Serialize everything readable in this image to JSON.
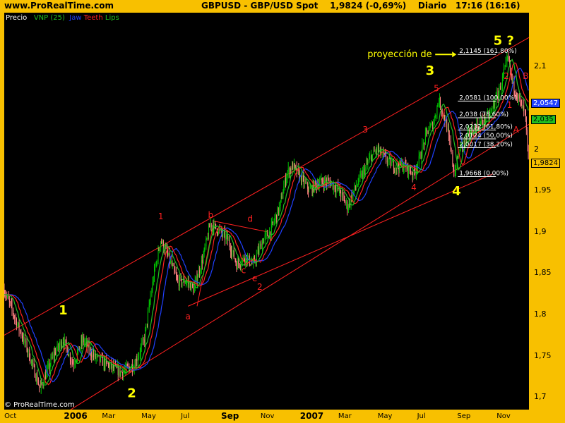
{
  "header": {
    "site": "www.ProRealTime.com",
    "symbol": "GBPUSD - GBP/USD Spot",
    "price": "1,9824 (-0,69%)",
    "period": "Diario",
    "time": "17:16 (16:16)"
  },
  "legend": {
    "price": "Precio",
    "vnp": "VNP (25)",
    "jaw": "Jaw",
    "teeth": "Teeth",
    "lips": "Lips"
  },
  "copyright": "© ProRealTime.com",
  "colors": {
    "background": "#f8c000",
    "plot": "#000000",
    "bull": "#00c000",
    "bear": "#ff8080",
    "jaw": "#2040ff",
    "teeth": "#ff2020",
    "lips": "#20c020",
    "channel": "#ff2020",
    "wave_label": "#ffff00",
    "sub_label": "#ff2020"
  },
  "chart_data": {
    "type": "candlestick",
    "ylim": [
      1.685,
      2.165
    ],
    "y_ticks": [
      "2,1",
      "2",
      "1,95",
      "1,9",
      "1,85",
      "1,8",
      "1,75",
      "1,7"
    ],
    "y_tick_values": [
      2.1,
      2.0,
      1.95,
      1.9,
      1.85,
      1.8,
      1.75,
      1.7
    ],
    "x_ticks": [
      "Oct",
      "2006",
      "Mar",
      "May",
      "Jul",
      "Sep",
      "Nov",
      "2007",
      "Mar",
      "May",
      "Jul",
      "Sep",
      "Nov"
    ],
    "x_ticks_year": [
      false,
      true,
      false,
      false,
      false,
      true,
      false,
      true,
      false,
      false,
      false,
      false,
      false
    ],
    "x_range": [
      "2005-09-20",
      "2007-12-10"
    ],
    "x_tick_dates": [
      "2005-10-01",
      "2006-01-01",
      "2006-03-01",
      "2006-05-01",
      "2006-07-01",
      "2006-09-01",
      "2006-11-01",
      "2007-01-01",
      "2007-03-01",
      "2007-05-01",
      "2007-07-01",
      "2007-09-01",
      "2007-11-01"
    ],
    "path": [
      [
        "2005-09-20",
        1.83
      ],
      [
        "2005-10-05",
        1.8
      ],
      [
        "2005-10-25",
        1.76
      ],
      [
        "2005-11-15",
        1.71
      ],
      [
        "2005-12-05",
        1.75
      ],
      [
        "2005-12-20",
        1.77
      ],
      [
        "2006-01-05",
        1.74
      ],
      [
        "2006-01-20",
        1.77
      ],
      [
        "2006-02-05",
        1.75
      ],
      [
        "2006-02-25",
        1.74
      ],
      [
        "2006-03-20",
        1.73
      ],
      [
        "2006-04-10",
        1.74
      ],
      [
        "2006-04-25",
        1.77
      ],
      [
        "2006-05-10",
        1.85
      ],
      [
        "2006-05-20",
        1.89
      ],
      [
        "2006-06-01",
        1.87
      ],
      [
        "2006-06-15",
        1.84
      ],
      [
        "2006-06-30",
        1.84
      ],
      [
        "2006-07-10",
        1.83
      ],
      [
        "2006-07-25",
        1.87
      ],
      [
        "2006-08-05",
        1.91
      ],
      [
        "2006-08-20",
        1.9
      ],
      [
        "2006-09-01",
        1.89
      ],
      [
        "2006-09-15",
        1.86
      ],
      [
        "2006-09-28",
        1.87
      ],
      [
        "2006-10-10",
        1.86
      ],
      [
        "2006-10-25",
        1.89
      ],
      [
        "2006-11-05",
        1.9
      ],
      [
        "2006-11-20",
        1.93
      ],
      [
        "2006-12-01",
        1.97
      ],
      [
        "2006-12-10",
        1.98
      ],
      [
        "2007-01-05",
        1.95
      ],
      [
        "2007-01-20",
        1.96
      ],
      [
        "2007-02-05",
        1.96
      ],
      [
        "2007-02-20",
        1.95
      ],
      [
        "2007-03-05",
        1.93
      ],
      [
        "2007-03-15",
        1.95
      ],
      [
        "2007-03-28",
        1.97
      ],
      [
        "2007-04-10",
        1.99
      ],
      [
        "2007-04-20",
        2.0
      ],
      [
        "2007-05-01",
        1.99
      ],
      [
        "2007-05-15",
        1.98
      ],
      [
        "2007-06-01",
        1.98
      ],
      [
        "2007-06-15",
        1.97
      ],
      [
        "2007-06-25",
        1.99
      ],
      [
        "2007-07-05",
        2.02
      ],
      [
        "2007-07-15",
        2.03
      ],
      [
        "2007-07-24",
        2.06
      ],
      [
        "2007-08-05",
        2.03
      ],
      [
        "2007-08-17",
        1.97
      ],
      [
        "2007-08-25",
        2.0
      ],
      [
        "2007-09-10",
        2.02
      ],
      [
        "2007-09-25",
        2.03
      ],
      [
        "2007-10-10",
        2.04
      ],
      [
        "2007-10-25",
        2.07
      ],
      [
        "2007-11-08",
        2.11
      ],
      [
        "2007-11-15",
        2.08
      ],
      [
        "2007-11-25",
        2.06
      ],
      [
        "2007-12-05",
        2.04
      ],
      [
        "2007-12-10",
        1.98
      ]
    ],
    "channel": [
      {
        "from": [
          "2005-09-20",
          1.775
        ],
        "to": [
          "2007-12-10",
          2.135
        ]
      },
      {
        "from": [
          "2005-12-01",
          1.67
        ],
        "to": [
          "2007-12-10",
          2.03
        ]
      },
      {
        "from": [
          "2006-07-01",
          1.81
        ],
        "to": [
          "2007-10-15",
          1.97
        ]
      },
      {
        "from": [
          "2006-08-10",
          1.913
        ],
        "to": [
          "2006-11-01",
          1.9
        ]
      },
      {
        "from": [
          "2006-08-10",
          1.913
        ],
        "to": [
          "2006-07-15",
          1.81
        ]
      }
    ],
    "fibonacci": [
      {
        "value": 2.1145,
        "label": "2,1145",
        "pct": "(161,80%)"
      },
      {
        "value": 2.0581,
        "label": "2,0581",
        "pct": "(100,00%)"
      },
      {
        "value": 2.038,
        "label": "2,038",
        "pct": "(78,60%)"
      },
      {
        "value": 2.0232,
        "label": "2,0232",
        "pct": "(61,80%)"
      },
      {
        "value": 2.0124,
        "label": "2,0124",
        "pct": "(50,00%)"
      },
      {
        "value": 2.0017,
        "label": "2,0017",
        "pct": "(38,20%)"
      },
      {
        "value": 1.9668,
        "label": "1,9668",
        "pct": "(0,00%)"
      }
    ],
    "fib_x": [
      "2007-08-22",
      "2007-10-20"
    ],
    "projection_label": "proyección de",
    "wave_labels": [
      {
        "text": "1",
        "x": "2005-12-20",
        "y": 1.8,
        "color": "yellow"
      },
      {
        "text": "2",
        "x": "2006-04-05",
        "y": 1.7,
        "color": "yellow"
      },
      {
        "text": "3",
        "x": "2007-07-10",
        "y": 2.09,
        "color": "yellow"
      },
      {
        "text": "4",
        "x": "2007-08-20",
        "y": 1.944,
        "color": "yellow"
      },
      {
        "text": "5 ?",
        "x": "2007-11-01",
        "y": 2.126,
        "color": "yellow"
      },
      {
        "text": "1",
        "x": "2006-05-20",
        "y": 1.915,
        "color": "red"
      },
      {
        "text": "2",
        "x": "2006-10-20",
        "y": 1.83,
        "color": "red"
      },
      {
        "text": "3",
        "x": "2007-04-01",
        "y": 2.02,
        "color": "red"
      },
      {
        "text": "4",
        "x": "2007-06-15",
        "y": 1.95,
        "color": "red"
      },
      {
        "text": "5",
        "x": "2007-07-20",
        "y": 2.07,
        "color": "red"
      },
      {
        "text": "a",
        "x": "2006-07-01",
        "y": 1.794,
        "color": "red"
      },
      {
        "text": "b",
        "x": "2006-08-05",
        "y": 1.917,
        "color": "red"
      },
      {
        "text": "c",
        "x": "2006-09-25",
        "y": 1.85,
        "color": "red"
      },
      {
        "text": "d",
        "x": "2006-10-05",
        "y": 1.912,
        "color": "red"
      },
      {
        "text": "e",
        "x": "2006-10-12",
        "y": 1.84,
        "color": "red"
      },
      {
        "text": "2",
        "x": "2007-11-05",
        "y": 2.085,
        "color": "red"
      },
      {
        "text": "B",
        "x": "2007-12-05",
        "y": 2.085,
        "color": "red"
      },
      {
        "text": "1",
        "x": "2007-11-10",
        "y": 2.05,
        "color": "red"
      },
      {
        "text": "A",
        "x": "2007-11-20",
        "y": 2.02,
        "color": "red"
      }
    ],
    "price_badges": [
      {
        "label": "2,0547",
        "y": 2.0547,
        "bg": "#2040ff",
        "fg": "#ffffff"
      },
      {
        "label": "2,035",
        "y": 2.035,
        "bg": "#20c020",
        "fg": "#000000"
      },
      {
        "label": "1,9824",
        "y": 1.9824,
        "bg": "#f8c000",
        "fg": "#000000"
      }
    ]
  }
}
